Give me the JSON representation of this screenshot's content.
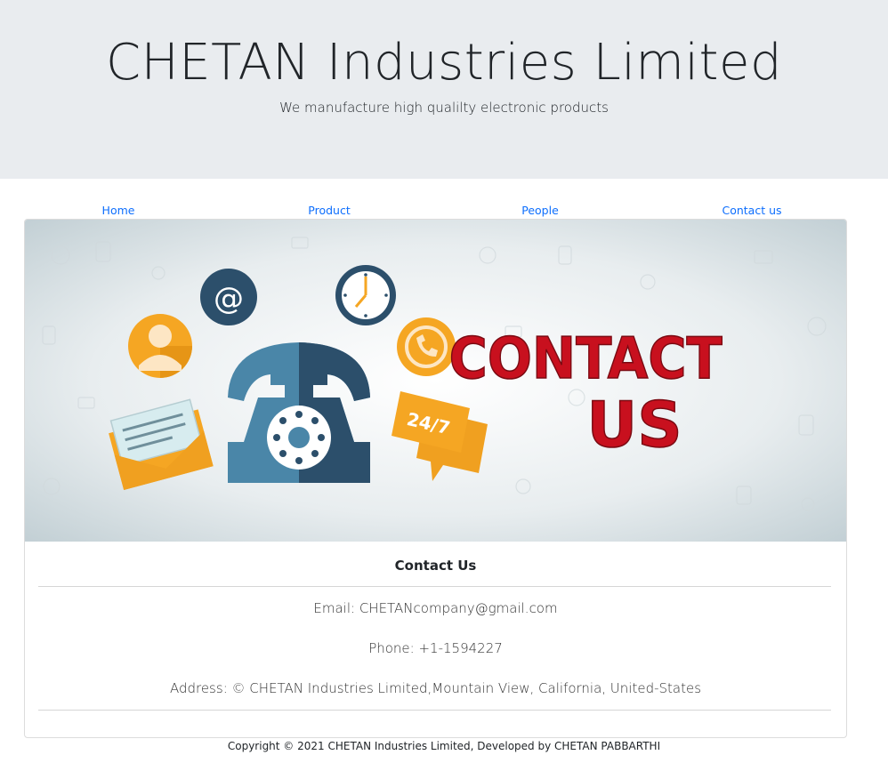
{
  "header": {
    "title": "CHETAN Industries Limited",
    "tagline": "We manufacture high qualilty electronic products"
  },
  "nav": {
    "items": [
      {
        "label": "Home"
      },
      {
        "label": "Product"
      },
      {
        "label": "People"
      },
      {
        "label": "Contact us"
      }
    ]
  },
  "banner": {
    "headline_line1": "CONTACT",
    "headline_line2": "US",
    "badge_text": "24/7",
    "at_symbol": "@",
    "icons": [
      "person-icon",
      "at-icon",
      "clock-icon",
      "phone-call-icon",
      "envelope-icon",
      "telephone-icon",
      "chat-bubble-icon"
    ],
    "colors": {
      "headline": "#c8101e",
      "orange": "#f5a623",
      "teal": "#2c4f6b",
      "blue": "#4a86a8"
    }
  },
  "contact": {
    "title": "Contact Us",
    "email": "Email: CHETANcompany@gmail.com",
    "phone": "Phone: +1-1594227",
    "address": "Address: © CHETAN Industries Limited,Mountain View, California, United-States"
  },
  "footer": {
    "copyright": "Copyright © 2021 CHETAN Industries Limited, Developed by CHETAN PABBARTHI"
  }
}
